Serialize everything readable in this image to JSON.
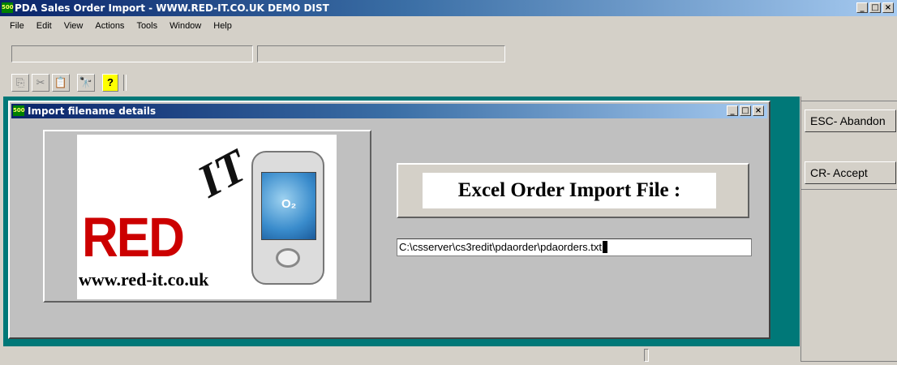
{
  "window": {
    "icon_label": "500",
    "title": "PDA Sales Order Import - WWW.RED-IT.CO.UK DEMO DIST",
    "buttons": {
      "minimize": "_",
      "maximize": "□",
      "close": "×"
    }
  },
  "menubar": {
    "items": [
      "File",
      "Edit",
      "View",
      "Actions",
      "Tools",
      "Window",
      "Help"
    ]
  },
  "toolbar": {
    "buttons": [
      {
        "name": "copy-icon",
        "glyph": "⎘"
      },
      {
        "name": "cut-icon",
        "glyph": "✂"
      },
      {
        "name": "paste-icon",
        "glyph": "📋"
      },
      {
        "name": "find-icon",
        "glyph": "🔭"
      },
      {
        "name": "help-icon",
        "glyph": "?"
      }
    ]
  },
  "side_panel": {
    "abandon_label": "ESC- Abandon",
    "accept_label": "CR- Accept"
  },
  "dialog": {
    "icon_label": "500",
    "title": "Import filename details",
    "buttons": {
      "minimize": "_",
      "maximize": "□",
      "close": "×"
    },
    "logo": {
      "brand_text": "RED",
      "it_text": "IT",
      "website": "www.red-it.co.uk",
      "device_text": "O₂"
    },
    "field_label": "Excel Order Import File :",
    "file_path": "C:\\csserver\\cs3redit\\pdaorder\\pdaorders.txt"
  }
}
